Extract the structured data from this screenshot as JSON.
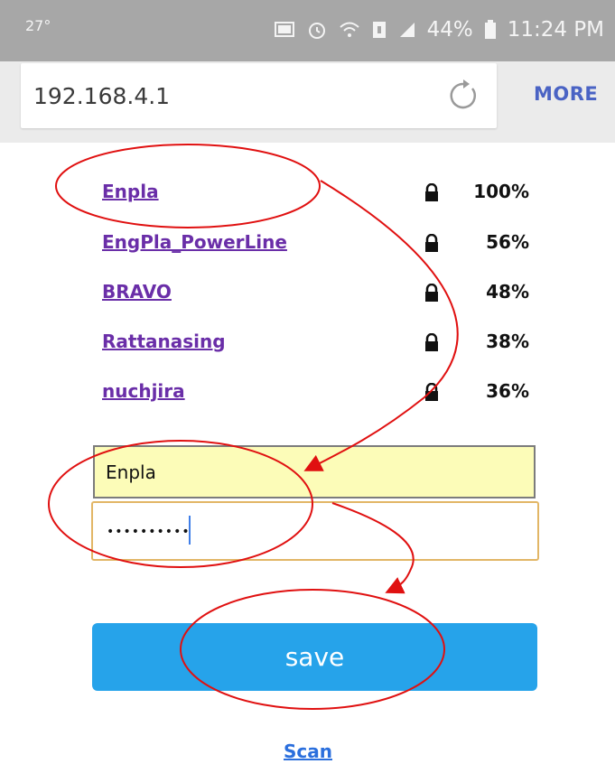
{
  "status_bar": {
    "temperature": "27°",
    "battery": "44%",
    "time": "11:24 PM",
    "icons": [
      "cast-icon",
      "alarm-icon",
      "wifi-icon",
      "sim-icon",
      "signal-icon",
      "battery-icon"
    ]
  },
  "browser": {
    "url": "192.168.4.1",
    "more_label": "MORE"
  },
  "networks": [
    {
      "ssid": "Enpla",
      "signal": "100%"
    },
    {
      "ssid": "EngPla_PowerLine",
      "signal": "56%"
    },
    {
      "ssid": "BRAVO",
      "signal": "48%"
    },
    {
      "ssid": "Rattanasing",
      "signal": "38%"
    },
    {
      "ssid": "nuchjira",
      "signal": "36%"
    }
  ],
  "form": {
    "ssid_value": "Enpla",
    "password_masked": "••••••••••",
    "save_label": "save",
    "scan_label": "Scan"
  },
  "colors": {
    "status_bar": "#a7a7a7",
    "link": "#6a2ea8",
    "save_button": "#26a3ea",
    "annotation": "#e01010"
  }
}
